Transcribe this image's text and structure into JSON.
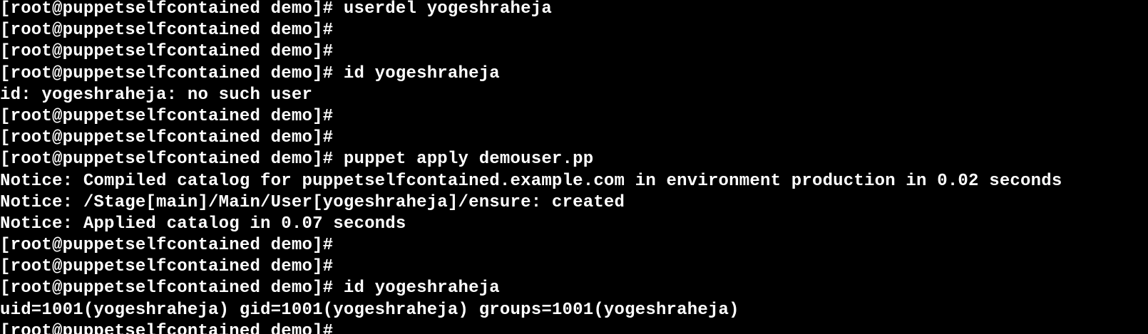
{
  "terminal": {
    "background": "#000000",
    "foreground": "#ffffff",
    "lines": [
      "[root@puppetselfcontained demo]# userdel yogeshraheja",
      "[root@puppetselfcontained demo]#",
      "[root@puppetselfcontained demo]#",
      "[root@puppetselfcontained demo]# id yogeshraheja",
      "id: yogeshraheja: no such user",
      "[root@puppetselfcontained demo]#",
      "[root@puppetselfcontained demo]#",
      "[root@puppetselfcontained demo]# puppet apply demouser.pp",
      "Notice: Compiled catalog for puppetselfcontained.example.com in environment production in 0.02 seconds",
      "Notice: /Stage[main]/Main/User[yogeshraheja]/ensure: created",
      "Notice: Applied catalog in 0.07 seconds",
      "[root@puppetselfcontained demo]#",
      "[root@puppetselfcontained demo]#",
      "[root@puppetselfcontained demo]# id yogeshraheja",
      "uid=1001(yogeshraheja) gid=1001(yogeshraheja) groups=1001(yogeshraheja)",
      "[root@puppetselfcontained demo]#"
    ]
  }
}
